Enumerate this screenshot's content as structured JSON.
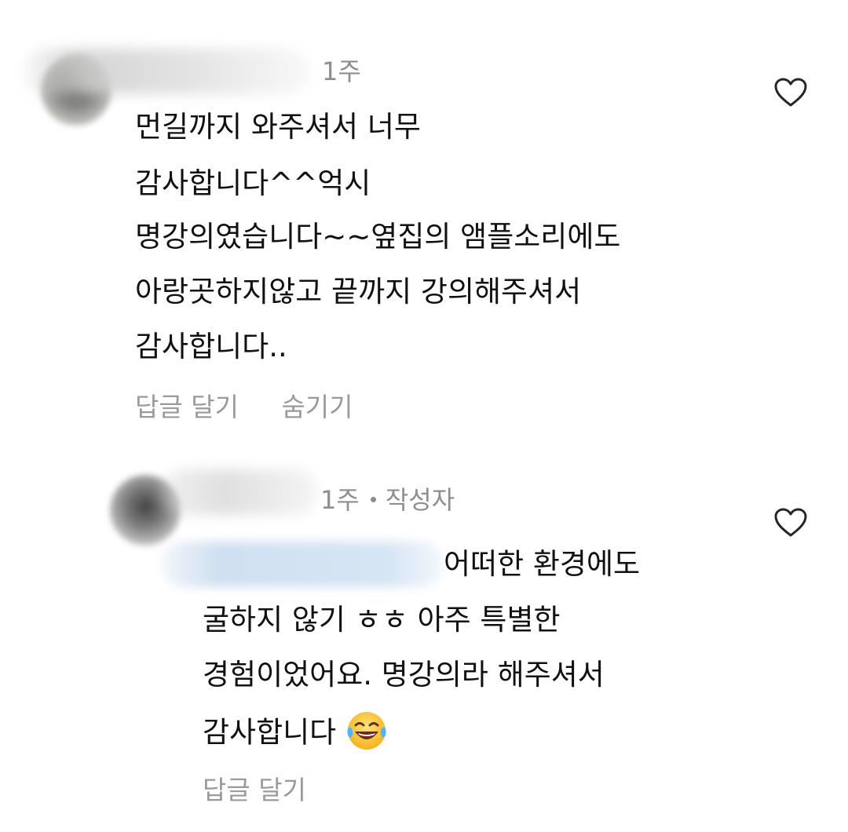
{
  "comments": [
    {
      "time": "1주",
      "author_badge": "",
      "lines": [
        "먼길까지 와주셔서 너무",
        "감사합니다^^억시",
        "명강의였습니다~~옆집의 앰플소리에도",
        "아랑곳하지않고 끝까지 강의해주셔서",
        "감사합니다.."
      ],
      "actions": [
        "답글 달기",
        "숨기기"
      ]
    },
    {
      "time": "1주",
      "author_badge": "작성자",
      "lines": [
        "어떠한 환경에도",
        "굴하지 않기 ㅎㅎ 아주 특별한",
        "경험이었어요. 명강의라 해주셔서",
        "감사합니다"
      ],
      "emoji": "face-with-tears-of-joy",
      "actions": [
        "답글 달기"
      ]
    }
  ],
  "icons": {
    "like": "heart-outline-icon"
  },
  "colors": {
    "text": "#111111",
    "meta": "#8e8e8e",
    "action": "#9a9a9a",
    "background": "#ffffff"
  }
}
